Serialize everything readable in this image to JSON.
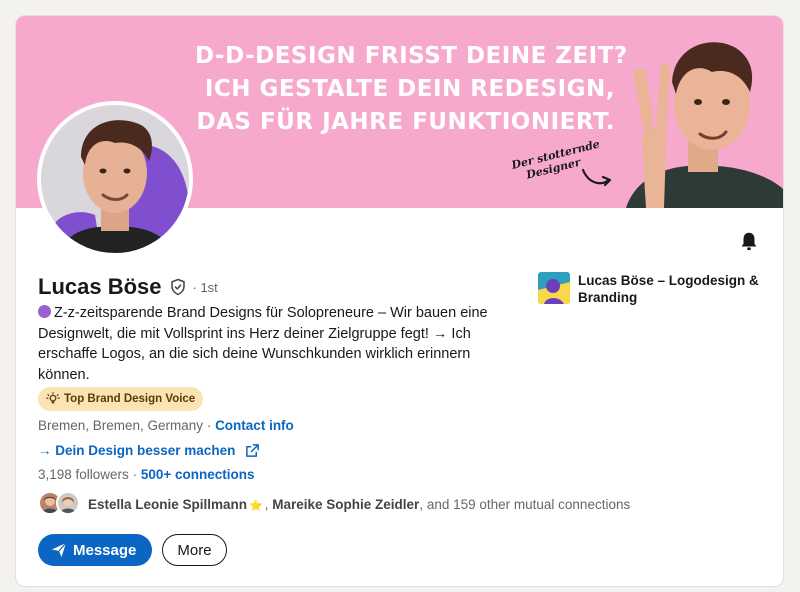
{
  "banner": {
    "headline_lines": [
      "D-D-Design frisst deine Zeit?",
      "Ich gestalte dein Redesign,",
      "das für Jahre funktioniert."
    ],
    "tagline_lines": [
      "Der stotternde",
      "Designer"
    ]
  },
  "profile": {
    "name": "Lucas Böse",
    "degree": "· 1st",
    "headline": "Z-z-zeitsparende Brand Designs für Solopreneure – Wir bauen eine Designwelt, die mit Vollsprint ins Herz deiner Zielgruppe fegt! → Ich erschaffe Logos, an die sich deine Wunschkunden wirklich erinnern können.",
    "voice_badge": "Top Brand Design Voice",
    "location": "Bremen, Bremen, Germany",
    "separator": " · ",
    "contact_info": "Contact info",
    "website": "→ Dein Design besser machen",
    "followers": "3,198 followers",
    "followers_sep": " · ",
    "connections": "500+ connections"
  },
  "mutual": {
    "name1": "Estella Leonie Spillmann",
    "star": "⭐",
    "comma": ", ",
    "name2": "Mareike Sophie Zeidler",
    "suffix": ", and 159 other mutual connections"
  },
  "company": {
    "name": "Lucas Böse – Logodesign & Branding"
  },
  "actions": {
    "message_label": "Message",
    "more_label": "More"
  },
  "colors": {
    "banner": "#f7a9cd",
    "link": "#0a66c2",
    "badge_bg": "#fbe3b4",
    "avatar_accent": "#7f4fd0"
  },
  "icons": [
    "verified-shield-icon",
    "bell-icon",
    "lightbulb-icon",
    "external-link-icon",
    "send-icon"
  ]
}
